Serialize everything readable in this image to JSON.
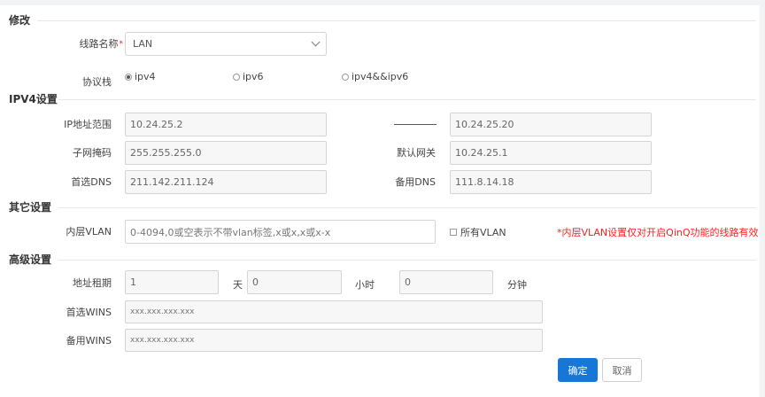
{
  "sections": {
    "modify": "修改",
    "ipv4": "IPV4设置",
    "other": "其它设置",
    "advanced": "高级设置"
  },
  "line_name": {
    "label": "线路名称",
    "required_mark": "*",
    "value": "LAN"
  },
  "protocol": {
    "label": "协议栈",
    "options": [
      "ipv4",
      "ipv6",
      "ipv4&&ipv6"
    ],
    "selected": "ipv4"
  },
  "ipv4": {
    "ip_range_label": "IP地址范围",
    "ip_start": "10.24.25.2",
    "ip_end": "10.24.25.20",
    "subnet_label": "子网掩码",
    "subnet": "255.255.255.0",
    "gateway_label": "默认网关",
    "gateway": "10.24.25.1",
    "dns1_label": "首选DNS",
    "dns1": "211.142.211.124",
    "dns2_label": "备用DNS",
    "dns2": "111.8.14.18"
  },
  "other": {
    "vlan_label": "内层VLAN",
    "vlan_placeholder": "0-4094,0或空表示不带vlan标签,x或x,x或x-x",
    "all_vlan_label": "所有VLAN",
    "all_vlan_checked": false,
    "warning": "*内层VLAN设置仅对开启QinQ功能的线路有效"
  },
  "advanced": {
    "lease_label": "地址租期",
    "days": "1",
    "days_unit": "天",
    "hours": "0",
    "hours_unit": "小时",
    "minutes": "0",
    "minutes_unit": "分钟",
    "wins1_label": "首选WINS",
    "wins1": "xxx.xxx.xxx.xxx",
    "wins2_label": "备用WINS",
    "wins2": "xxx.xxx.xxx.xxx"
  },
  "buttons": {
    "confirm": "确定",
    "cancel": "取消"
  },
  "colors": {
    "primary": "#1677d9",
    "warning": "#ff1f1f"
  }
}
